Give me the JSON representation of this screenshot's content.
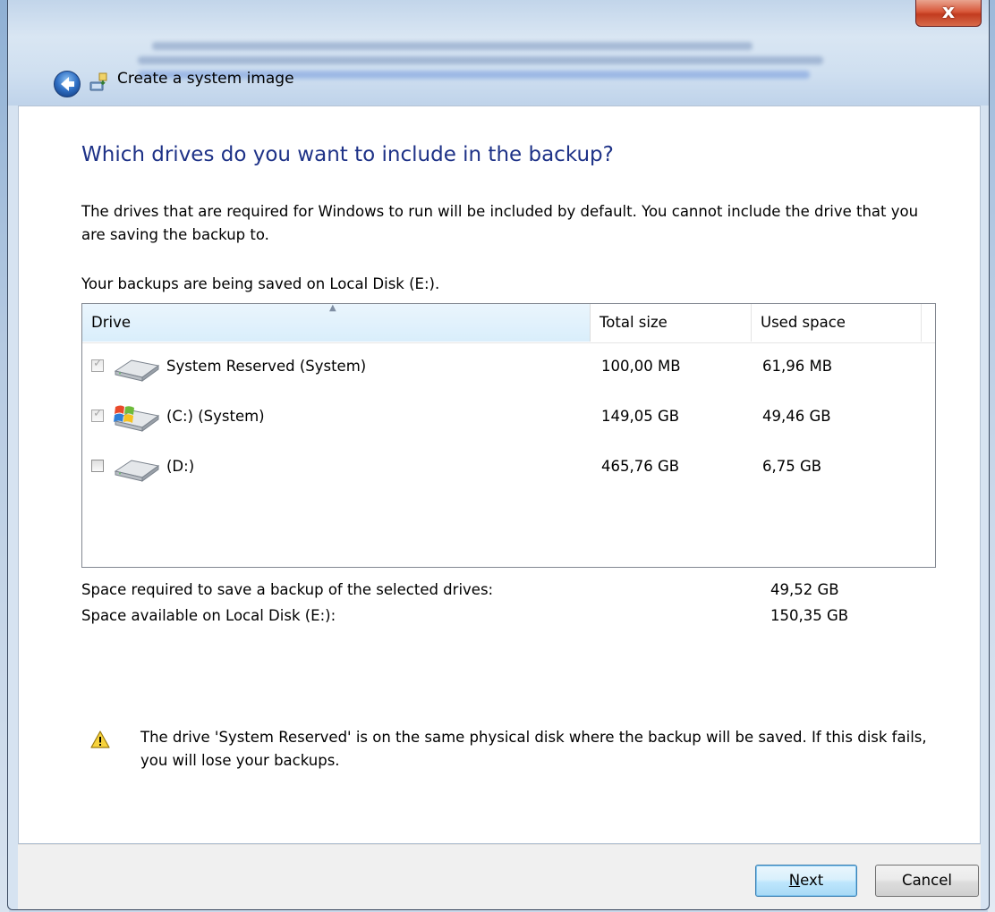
{
  "window": {
    "title": "Create a system image",
    "close_label": "x"
  },
  "page": {
    "heading": "Which drives do you want to include in the backup?",
    "description": "The drives that are required for Windows to run will be included by default. You cannot include the drive that you are saving the backup to.",
    "saved_on": "Your backups are being saved on Local Disk (E:)."
  },
  "table": {
    "columns": [
      "Drive",
      "Total size",
      "Used space"
    ],
    "sort_indicator": "▲",
    "rows": [
      {
        "name": "System Reserved (System)",
        "total": "100,00 MB",
        "used": "61,96 MB",
        "checked": true,
        "enabled": false,
        "icon": "hard-drive-icon"
      },
      {
        "name": "(C:) (System)",
        "total": "149,05 GB",
        "used": "49,46 GB",
        "checked": true,
        "enabled": false,
        "icon": "windows-drive-icon"
      },
      {
        "name": "(D:)",
        "total": "465,76 GB",
        "used": "6,75 GB",
        "checked": false,
        "enabled": true,
        "icon": "hard-drive-icon"
      }
    ]
  },
  "summary": {
    "required_label": "Space required to save a backup of the selected drives:",
    "required_value": "49,52 GB",
    "available_label": "Space available on Local Disk (E:):",
    "available_value": "150,35 GB"
  },
  "warning": {
    "icon": "warning-icon",
    "text": "The drive 'System Reserved' is on the same physical disk where the backup will be saved. If this disk fails, you will lose your backups."
  },
  "buttons": {
    "next_access_key": "N",
    "next_rest": "ext",
    "cancel": "Cancel"
  },
  "colors": {
    "heading": "#1e3287",
    "close_button": "#c23b1f",
    "selected_column": "#d9eefb"
  }
}
